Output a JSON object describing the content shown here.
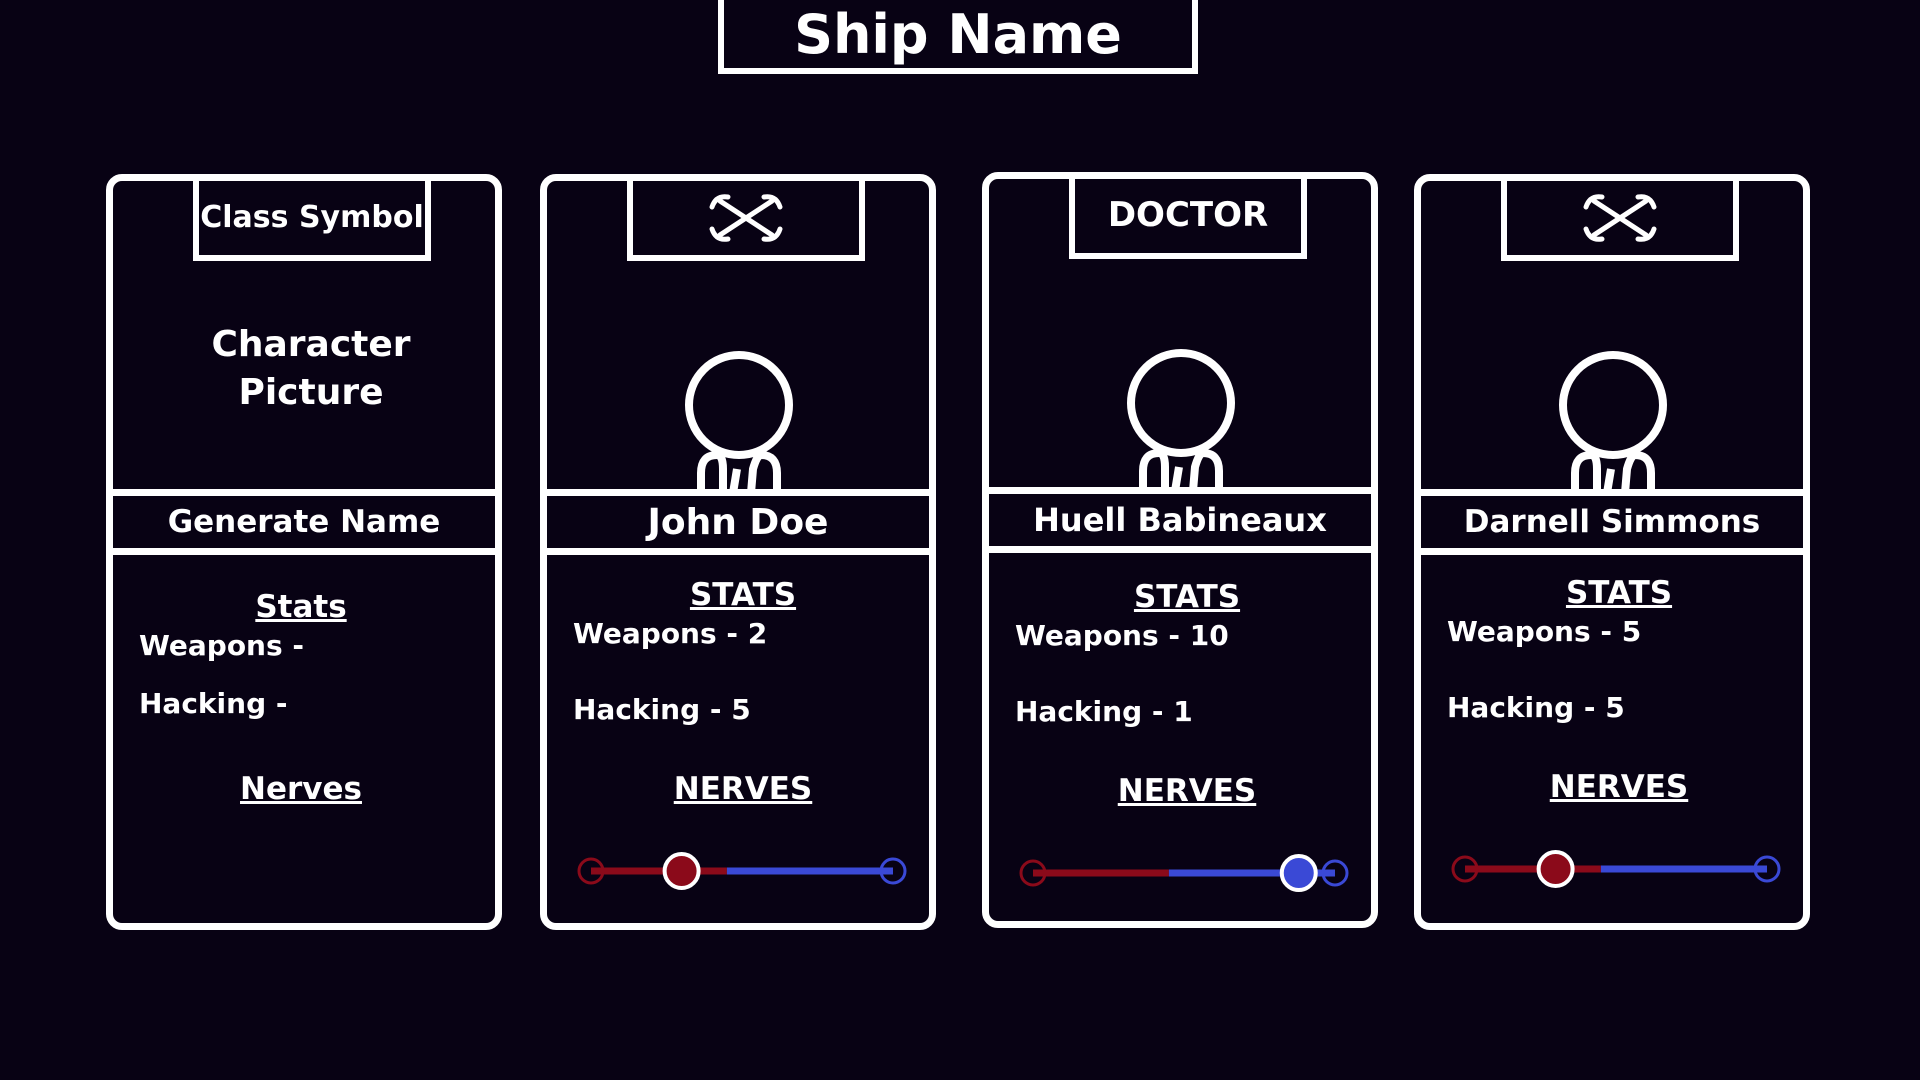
{
  "ship": {
    "name": "Ship Name"
  },
  "cards": [
    {
      "class_label": "Class Symbol",
      "picture_label": "Character Picture",
      "name": "Generate Name",
      "stats_title": "Stats",
      "weapons_label": "Weapons -",
      "weapons_value": "",
      "hacking_label": "Hacking -",
      "hacking_value": "",
      "nerves_title": "Nerves"
    },
    {
      "class_icon": "wrench-icon",
      "name": "John Doe",
      "stats_title": "STATS",
      "weapons_label": "Weapons -",
      "weapons_value": "2",
      "hacking_label": "Hacking -",
      "hacking_value": "5",
      "nerves_title": "NERVES",
      "nerves_level": 0.3
    },
    {
      "class_label": "DOCTOR",
      "name": "Huell Babineaux",
      "stats_title": "STATS",
      "weapons_label": "Weapons -",
      "weapons_value": "10",
      "hacking_label": "Hacking -",
      "hacking_value": "1",
      "nerves_title": "NERVES",
      "nerves_level": 0.88
    },
    {
      "class_icon": "wrench-icon",
      "name": "Darnell Simmons",
      "stats_title": "STATS",
      "weapons_label": "Weapons -",
      "weapons_value": "5",
      "hacking_label": "Hacking -",
      "hacking_value": "5",
      "nerves_title": "NERVES",
      "nerves_level": 0.3
    }
  ],
  "colors": {
    "background": "#080214",
    "fear": "#8b0a1a",
    "calm": "#3a49d6",
    "outline": "#ffffff"
  }
}
